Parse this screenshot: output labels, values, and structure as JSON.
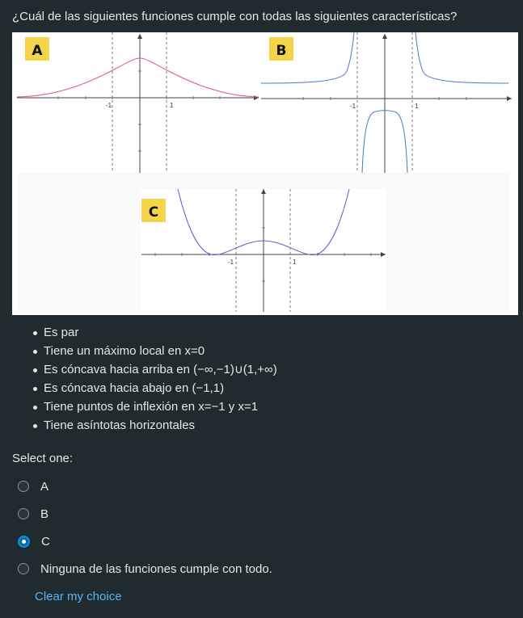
{
  "question": {
    "text": "¿Cuál de las siguientes funciones cumple con todas las siguientes características?"
  },
  "figure": {
    "panels": [
      {
        "label": "A",
        "tick_neg": "-1",
        "tick_pos": "1"
      },
      {
        "label": "B",
        "tick_neg": "-1",
        "tick_pos": "1"
      },
      {
        "label": "C",
        "tick_neg": "-1",
        "tick_pos": "1"
      }
    ],
    "colors": {
      "tag_bg": "#f5d44a",
      "curve_a": "#e05a6a",
      "curve_b": "#4a78c8",
      "curve_c": "#7a4ad0"
    }
  },
  "criteria": [
    "Es par",
    "Tiene un máximo local en x=0",
    "Es cóncava hacia arriba en (−∞,−1)∪(1,+∞)",
    "Es cóncava hacia abajo en (−1,1)",
    "Tiene puntos de inflexión en x=−1 y x=1",
    "Tiene asíntotas horizontales"
  ],
  "answer": {
    "prompt": "Select one:",
    "options": [
      {
        "label": "A",
        "checked": false
      },
      {
        "label": "B",
        "checked": false
      },
      {
        "label": "C",
        "checked": true
      },
      {
        "label": "Ninguna de las funciones cumple con todo.",
        "checked": false
      }
    ],
    "clear_label": "Clear my choice"
  }
}
